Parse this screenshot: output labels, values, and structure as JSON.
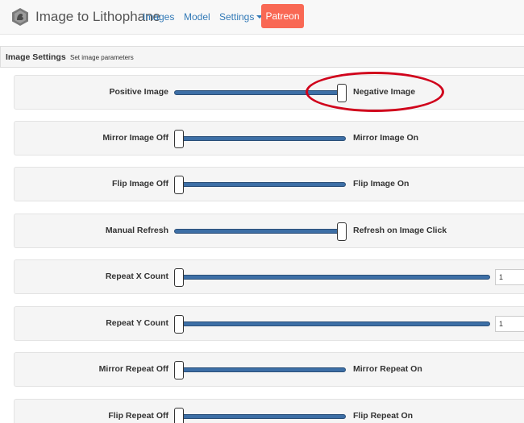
{
  "navbar": {
    "brand": "Image to Lithophane",
    "links": [
      "Images",
      "Model",
      "Settings"
    ],
    "patreon": "Patreon",
    "brand_icon": "lithophane-logo-icon",
    "patreon_color": "#f96854",
    "link_color": "#337ab7"
  },
  "panel": {
    "title": "Image Settings",
    "subtitle": "Set image parameters"
  },
  "settings": [
    {
      "left": "Positive Image",
      "right": "Negative Image",
      "state": "on"
    },
    {
      "left": "Mirror Image Off",
      "right": "Mirror Image On",
      "state": "off"
    },
    {
      "left": "Flip Image Off",
      "right": "Flip Image On",
      "state": "off"
    },
    {
      "left": "Manual Refresh",
      "right": "Refresh on Image Click",
      "state": "on"
    },
    {
      "left": "Repeat X Count",
      "value": "1"
    },
    {
      "left": "Repeat Y Count",
      "value": "1"
    },
    {
      "left": "Mirror Repeat Off",
      "right": "Mirror Repeat On",
      "state": "off"
    },
    {
      "left": "Flip Repeat Off",
      "right": "Flip Repeat On",
      "state": "off"
    }
  ],
  "slider_color": "#3d6fa6",
  "annotation_color": "#d0021b"
}
